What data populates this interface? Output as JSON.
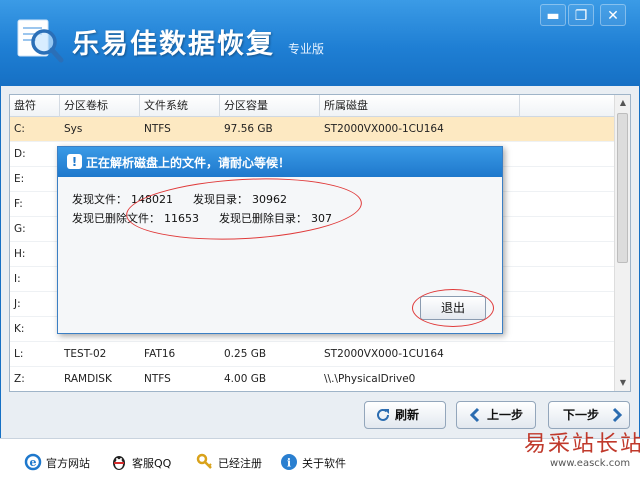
{
  "app": {
    "title": "乐易佳数据恢复",
    "edition": "专业版"
  },
  "window_controls": {
    "minimize": "▬",
    "maximize": "❐",
    "close": "✕"
  },
  "table": {
    "columns": [
      "盘符",
      "分区卷标",
      "文件系统",
      "分区容量",
      "所属磁盘"
    ],
    "rows": [
      {
        "drive": "C:",
        "label": "Sys",
        "fs": "NTFS",
        "size": "97.56 GB",
        "disk": "ST2000VX000-1CU164",
        "selected": true
      },
      {
        "drive": "D:",
        "label": "",
        "fs": "",
        "size": "",
        "disk": ""
      },
      {
        "drive": "E:",
        "label": "",
        "fs": "",
        "size": "",
        "disk": ""
      },
      {
        "drive": "F:",
        "label": "",
        "fs": "",
        "size": "",
        "disk": ""
      },
      {
        "drive": "G:",
        "label": "",
        "fs": "",
        "size": "",
        "disk": ""
      },
      {
        "drive": "H:",
        "label": "",
        "fs": "",
        "size": "",
        "disk": ""
      },
      {
        "drive": "I:",
        "label": "",
        "fs": "",
        "size": "",
        "disk": ""
      },
      {
        "drive": "J:",
        "label": "",
        "fs": "",
        "size": "",
        "disk": ""
      },
      {
        "drive": "K:",
        "label": "",
        "fs": "",
        "size": "",
        "disk": ""
      },
      {
        "drive": "L:",
        "label": "TEST-02",
        "fs": "FAT16",
        "size": "0.25 GB",
        "disk": "ST2000VX000-1CU164"
      },
      {
        "drive": "Z:",
        "label": "RAMDISK",
        "fs": "NTFS",
        "size": "4.00 GB",
        "disk": "\\\\.\\PhysicalDrive0"
      }
    ]
  },
  "dialog": {
    "title": "正在解析磁盘上的文件，请耐心等候！",
    "found_files_label": "发现文件：",
    "found_files": "148021",
    "found_dirs_label": "发现目录：",
    "found_dirs": "30962",
    "deleted_files_label": "发现已删除文件：",
    "deleted_files": "11653",
    "deleted_dirs_label": "发现已删除目录：",
    "deleted_dirs": "307",
    "exit_label": "退出"
  },
  "nav": {
    "refresh": "刷新",
    "prev": "上一步",
    "next": "下一步"
  },
  "footer": {
    "website": "官方网站",
    "qq": "客服QQ",
    "registered": "已经注册",
    "about": "关于软件"
  },
  "watermark": {
    "text": "易采站长站",
    "url": "www.easck.com"
  },
  "colors": {
    "titlebar": "#1f7fd4",
    "selected_row": "#fde9c2",
    "annotation": "#e03a3a"
  }
}
